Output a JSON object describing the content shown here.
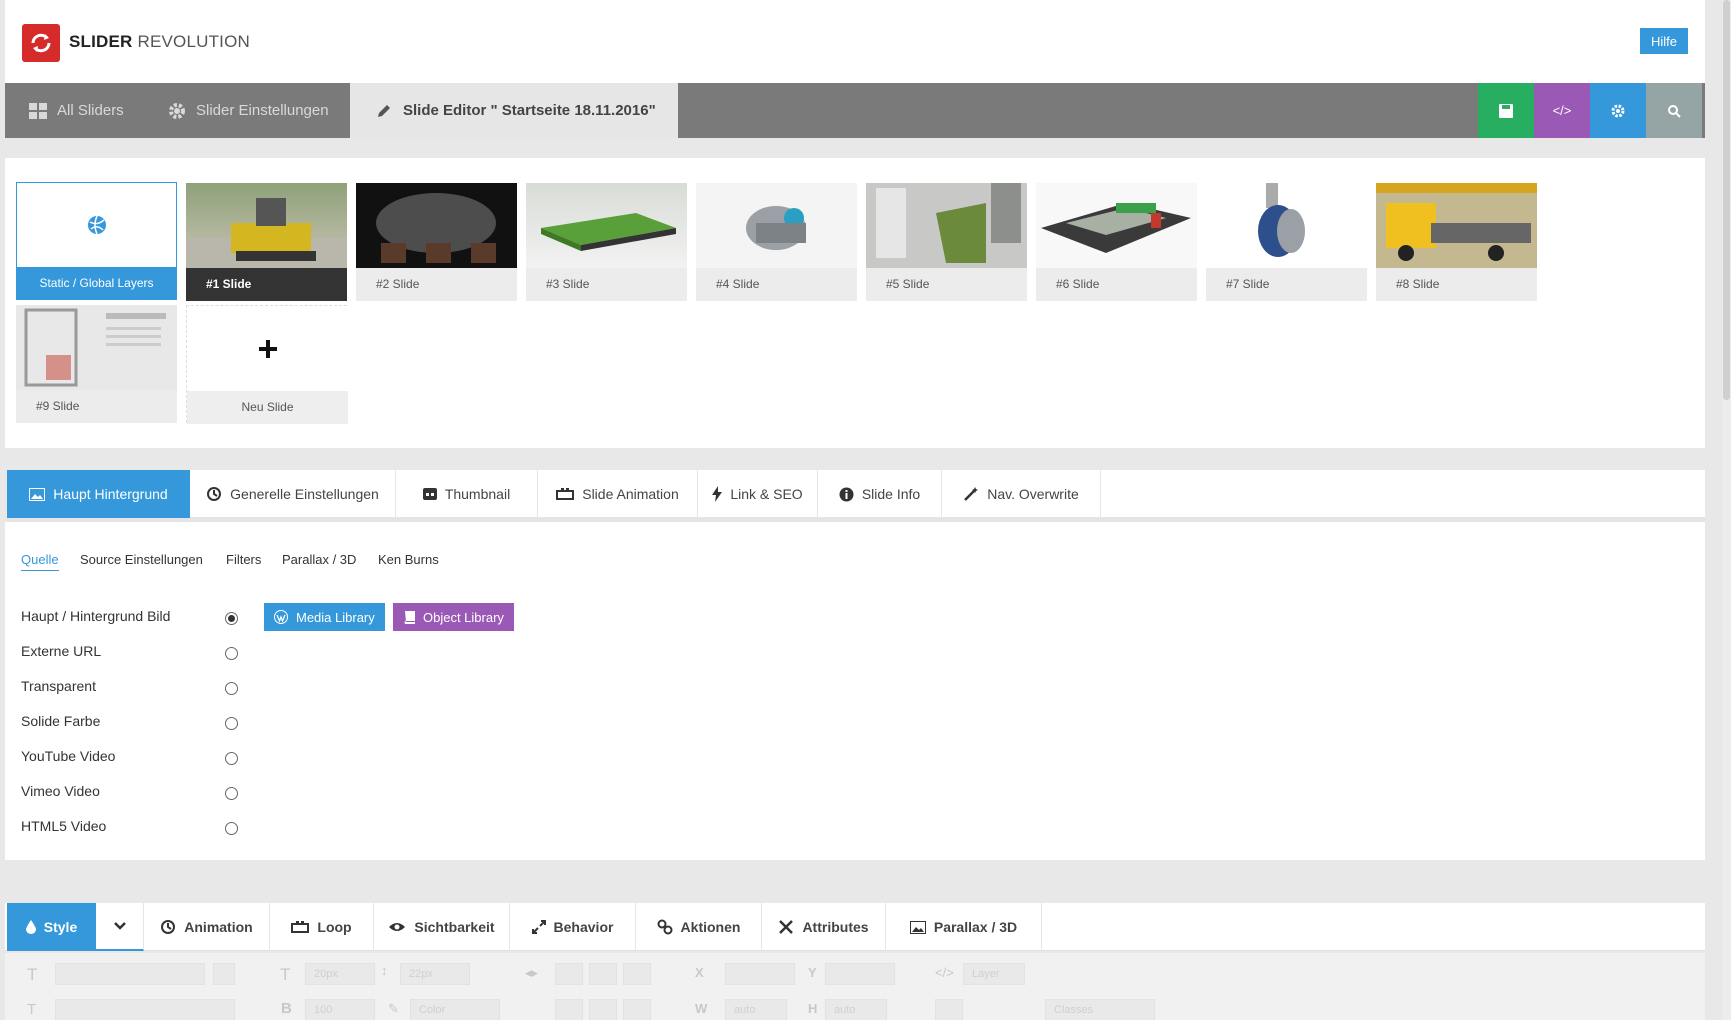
{
  "header": {
    "logo_bold": "SLIDER",
    "logo_light": "REVOLUTION",
    "help_label": "Hilfe"
  },
  "mainnav": {
    "all_sliders": "All Sliders",
    "slider_settings": "Slider Einstellungen",
    "slide_editor": "Slide Editor \" Startseite 18.11.2016\"",
    "btn_code": "</>"
  },
  "slides": {
    "static_label": "Static / Global Layers",
    "items": [
      "#1 Slide",
      "#2 Slide",
      "#3 Slide",
      "#4 Slide",
      "#5 Slide",
      "#6 Slide",
      "#7 Slide",
      "#8 Slide",
      "#9 Slide"
    ],
    "new_label": "Neu Slide"
  },
  "section_tabs": [
    "Haupt Hintergrund",
    "Generelle Einstellungen",
    "Thumbnail",
    "Slide Animation",
    "Link & SEO",
    "Slide Info",
    "Nav. Overwrite"
  ],
  "sub_tabs": [
    "Quelle",
    "Source Einstellungen",
    "Filters",
    "Parallax / 3D",
    "Ken Burns"
  ],
  "sources": [
    {
      "label": "Haupt / Hintergrund Bild",
      "selected": true
    },
    {
      "label": "Externe URL",
      "selected": false
    },
    {
      "label": "Transparent",
      "selected": false
    },
    {
      "label": "Solide Farbe",
      "selected": false
    },
    {
      "label": "YouTube Video",
      "selected": false
    },
    {
      "label": "Vimeo Video",
      "selected": false
    },
    {
      "label": "HTML5 Video",
      "selected": false
    }
  ],
  "library": {
    "media": "Media Library",
    "object": "Object Library"
  },
  "layer_tabs": [
    "Style",
    "Animation",
    "Loop",
    "Sichtbarkeit",
    "Behavior",
    "Aktionen",
    "Attributes",
    "Parallax / 3D"
  ],
  "toolbar": {
    "font_size": "20px",
    "line_height": "22px",
    "x_label": "X",
    "y_label": "Y",
    "w_label": "W",
    "h_label": "H",
    "weight": "100",
    "color": "Color",
    "width_val": "auto",
    "height_val": "auto",
    "classes": "Classes",
    "layer_id": "Layer",
    "t_icon": "T",
    "b_icon": "B"
  },
  "colors": {
    "accent": "#3498db",
    "save": "#27ae60",
    "code": "#9b59b6",
    "gear": "#3498db",
    "search": "#95a5a6",
    "logo": "#d52b2b",
    "object_library": "#9b59b6"
  }
}
